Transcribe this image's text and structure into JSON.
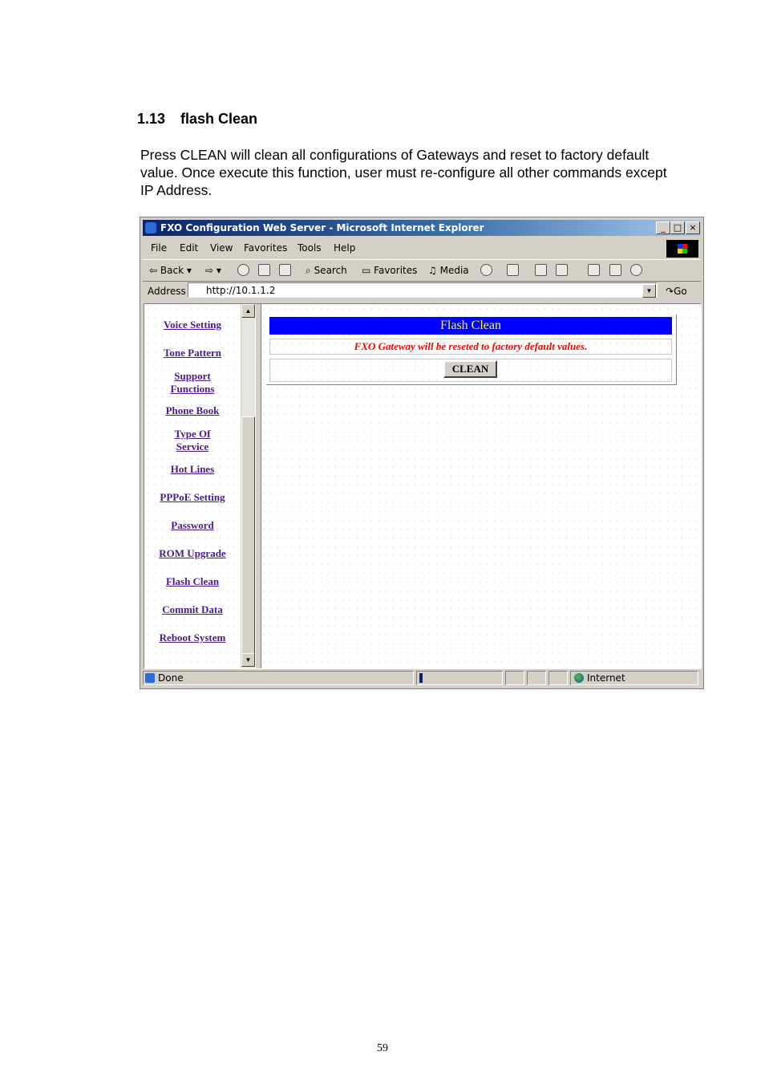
{
  "doc": {
    "section_number": "1.13",
    "section_title": "flash Clean",
    "paragraph": "Press CLEAN will clean all configurations of Gateways and reset to factory default value. Once execute this function, user must re-configure all other commands except IP Address.",
    "page_number": "59"
  },
  "browser": {
    "title": "FXO Configuration Web Server - Microsoft Internet Explorer",
    "window_buttons": [
      "_",
      "□",
      "×"
    ],
    "menu": [
      "File",
      "Edit",
      "View",
      "Favorites",
      "Tools",
      "Help"
    ],
    "toolbar": {
      "back": "Back",
      "search": "Search",
      "favorites": "Favorites",
      "media": "Media"
    },
    "address_label": "Address",
    "address_value": "http://10.1.1.2",
    "go_label": "Go",
    "status_text": "Done",
    "zone_text": "Internet"
  },
  "nav": [
    [
      "Voice Setting"
    ],
    [
      "Tone Pattern"
    ],
    [
      "Support",
      "Functions"
    ],
    [
      "Phone Book"
    ],
    [
      "Type Of",
      "Service"
    ],
    [
      "Hot Lines"
    ],
    [
      "PPPoE Setting"
    ],
    [
      "Password"
    ],
    [
      "ROM Upgrade"
    ],
    [
      "Flash Clean"
    ],
    [
      "Commit Data"
    ],
    [
      "Reboot System"
    ]
  ],
  "panel": {
    "title": "Flash Clean",
    "message": "FXO Gateway will be reseted to factory default values.",
    "button_label": "CLEAN"
  },
  "colors": {
    "panel_title_bg": "#0000ff",
    "panel_title_text": "#ffff00",
    "message_text": "#ff0000",
    "link": "#4a1a8c"
  }
}
